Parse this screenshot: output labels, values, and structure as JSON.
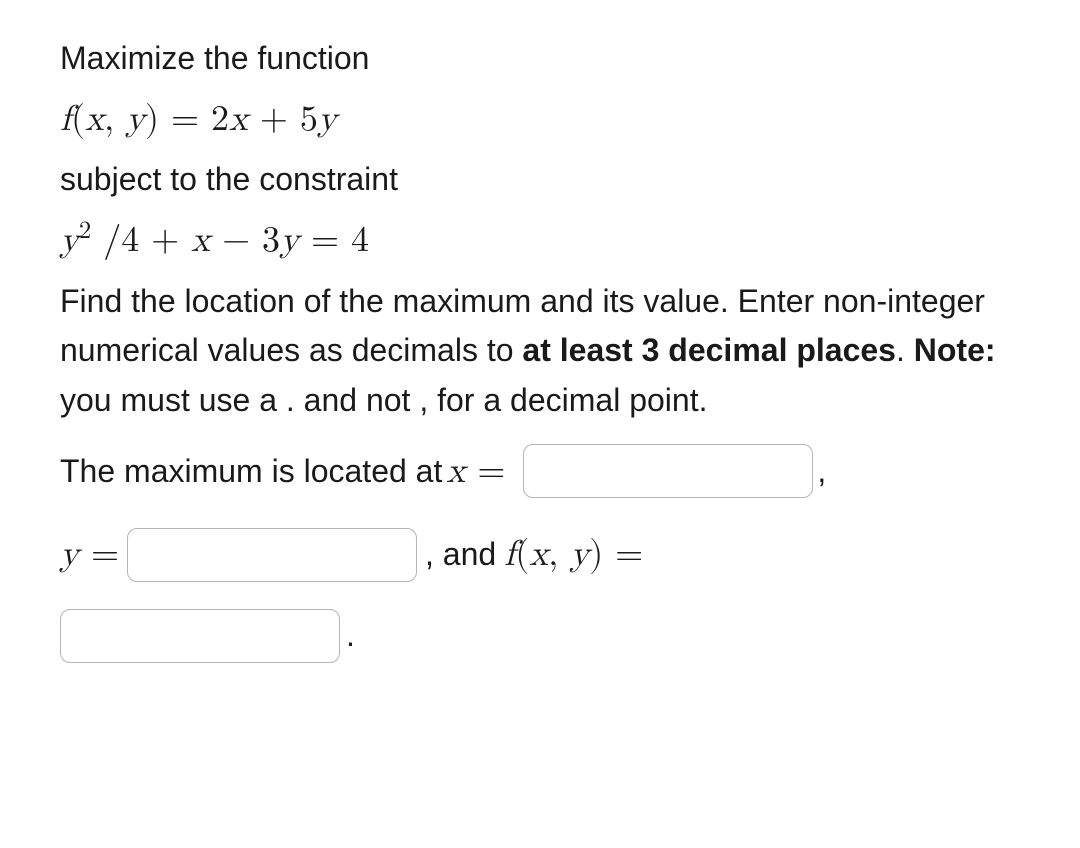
{
  "problem": {
    "intro": "Maximize the function",
    "function_expr": "f(x, y) = 2x + 5y",
    "subject_text": "subject to the constraint",
    "constraint_expr": "y² /4 + x − 3y = 4",
    "instructions_part1": "Find the location of the maximum and its value. Enter non-integer numerical values as decimals to ",
    "instructions_bold1": "at least 3 decimal places",
    "instructions_part2": ". ",
    "instructions_bold2": "Note:",
    "instructions_part3": " you must use a . and not , for a decimal point."
  },
  "answers": {
    "prompt_x": "The maximum is located at ",
    "x_equals": "x =",
    "comma": ",",
    "y_equals": "y =",
    "and_text": ", and ",
    "fxy_equals": "f(x, y) =",
    "period": "."
  },
  "inputs": {
    "x_value": "",
    "y_value": "",
    "f_value": ""
  }
}
